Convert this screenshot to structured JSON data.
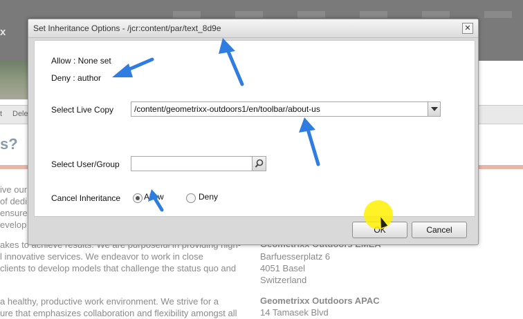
{
  "background": {
    "logo": "x",
    "toolbar_items": [
      "t",
      "Dele"
    ],
    "heading": "s?",
    "paragraph_lines": [
      "ive our",
      "of dedi",
      "ensure",
      "evelop s",
      "akes to achieve results. We are purposeful in providing high-",
      "l innovative services. We endeavor to work in close",
      "clients to develop models that challenge the status quo and"
    ],
    "paragraph2_lines": [
      "a healthy, productive work environment. We strive for a",
      "ure that emphasizes collaboration and flexibility amongst all"
    ],
    "addresses": [
      {
        "title": "Geometrixx Outdoors EMEA",
        "lines": [
          "Barfuesserplatz 6",
          "4051 Basel",
          "Switzerland"
        ]
      },
      {
        "title": "Geometrixx Outdoors APAC",
        "lines": [
          "14 Tamasek Blvd"
        ]
      }
    ]
  },
  "dialog": {
    "title": "Set Inheritance Options - /jcr:content/par/text_8d9e",
    "close_glyph": "✕",
    "allow_info": "Allow : None set",
    "deny_info": "Deny : author",
    "live_copy": {
      "label": "Select Live Copy",
      "value": "/content/geometrixx-outdoors1/en/toolbar/about-us"
    },
    "user_group": {
      "label": "Select User/Group",
      "value": ""
    },
    "cancel_inheritance": {
      "label": "Cancel Inheritance",
      "options": [
        "Allow",
        "Deny"
      ],
      "selected": "Allow"
    },
    "buttons": {
      "ok": "OK",
      "cancel": "Cancel"
    }
  },
  "annotation_color": "#2f7de1",
  "highlight_color": "#fff000"
}
